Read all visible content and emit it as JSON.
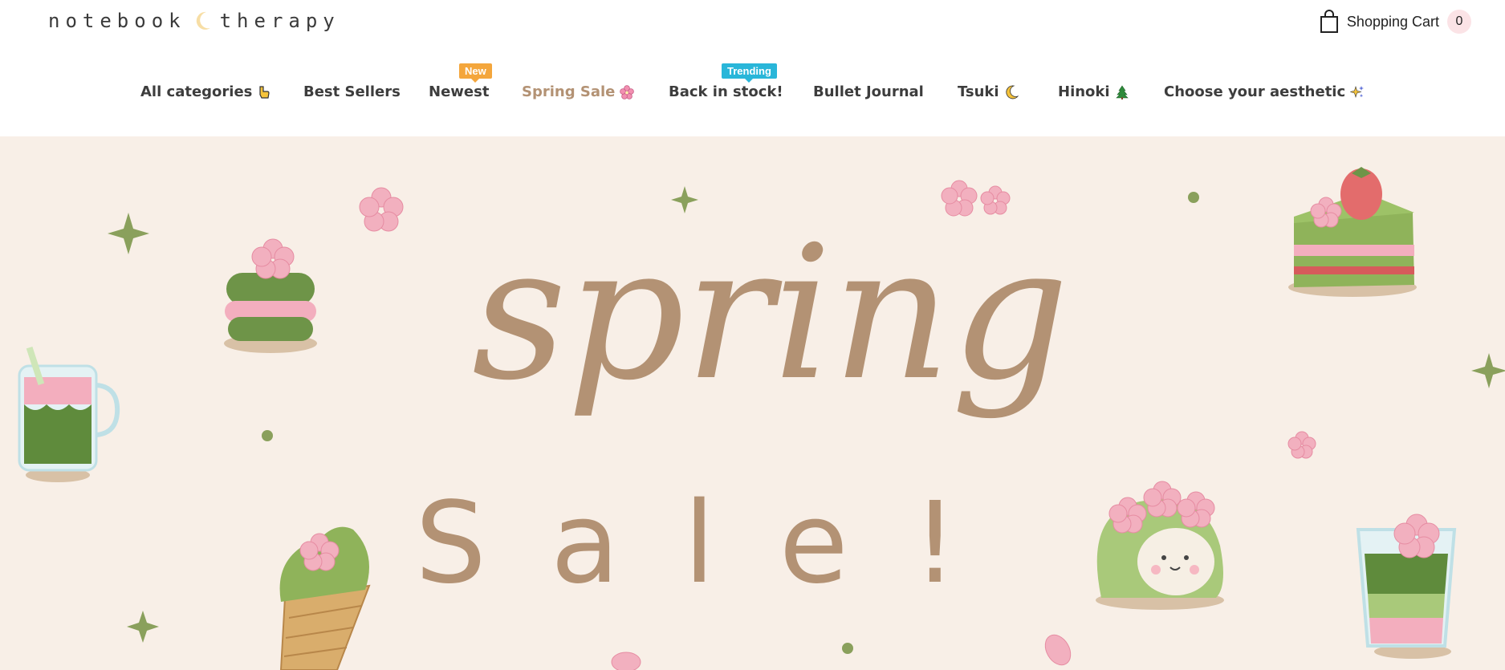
{
  "header": {
    "logo_text_left": "notebook",
    "logo_text_right": "therapy",
    "cart_label": "Shopping Cart",
    "cart_count": "0"
  },
  "nav": {
    "items": [
      {
        "label": "All categories",
        "emoji": "pointing-hand-icon"
      },
      {
        "label": "Best Sellers"
      },
      {
        "label": "Newest",
        "badge": "New"
      },
      {
        "label": "Spring Sale",
        "emoji": "cherry-blossom-icon"
      },
      {
        "label": "Back in stock!",
        "badge": "Trending"
      },
      {
        "label": "Bullet Journal"
      },
      {
        "label": "Tsuki",
        "emoji": "crescent-moon-icon"
      },
      {
        "label": "Hinoki",
        "emoji": "evergreen-tree-icon"
      },
      {
        "label": "Choose your aesthetic",
        "emoji": "sparkles-icon"
      }
    ]
  },
  "hero": {
    "headline_script": "spring",
    "headline_print": "Sale!"
  },
  "colors": {
    "hero_bg": "#f8efe7",
    "headline": "#b39274",
    "matcha": "#7a9a58",
    "sakura": "#f2aab8",
    "badge_new": "#f4a63c",
    "badge_trending": "#29b6d9"
  }
}
